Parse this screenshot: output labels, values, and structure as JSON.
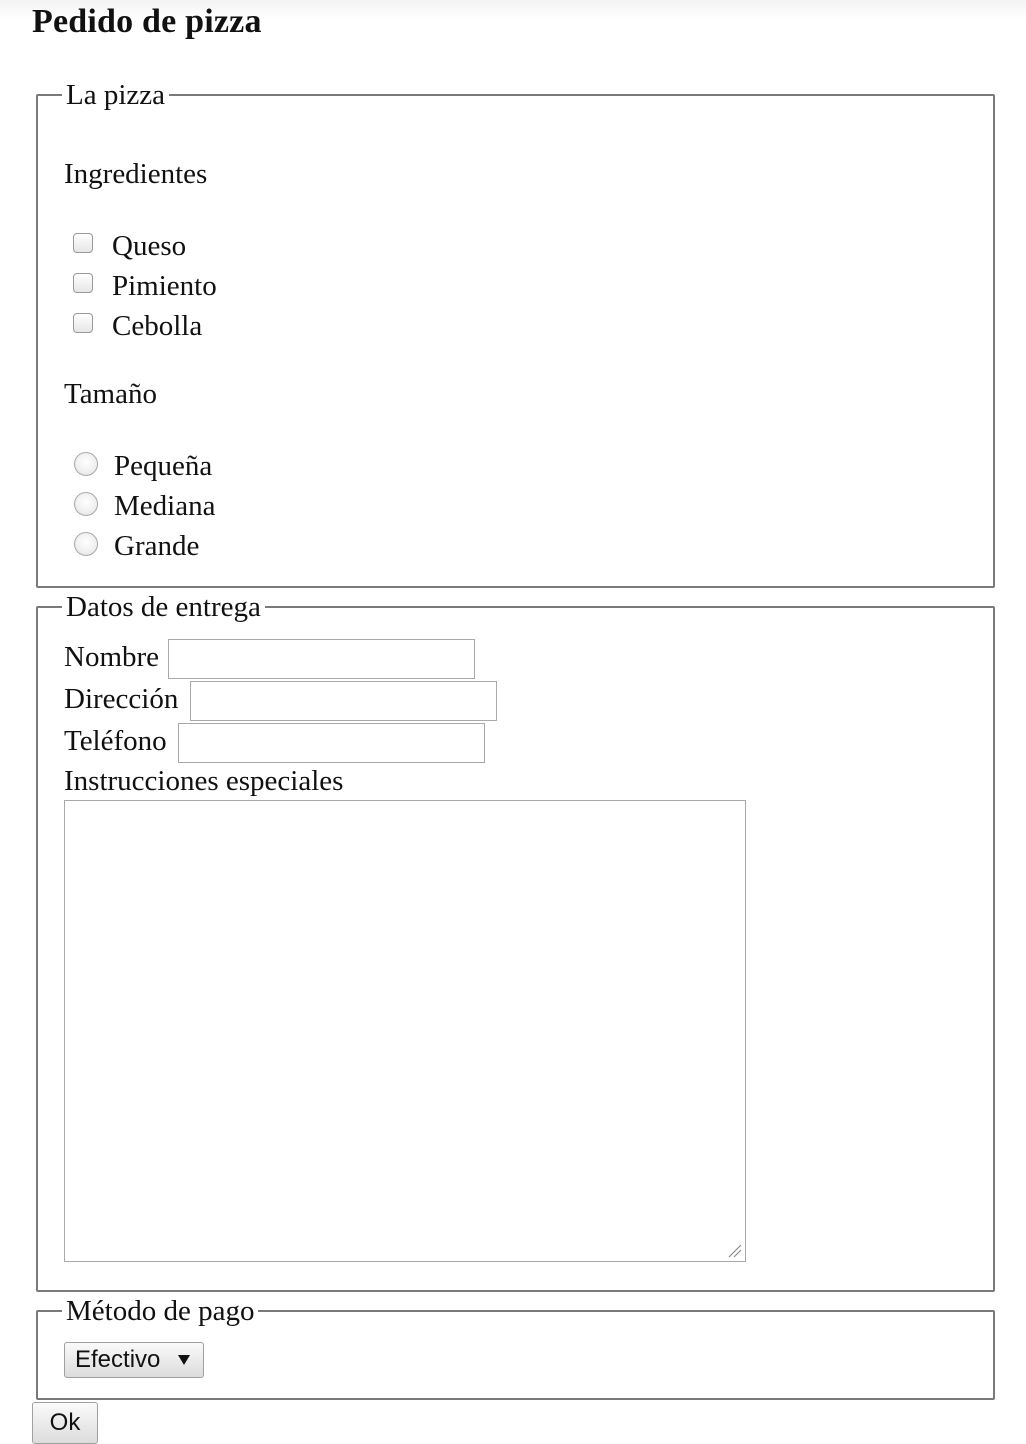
{
  "page": {
    "title": "Pedido de pizza"
  },
  "pizza": {
    "legend": "La pizza",
    "ingredients_title": "Ingredientes",
    "ingredients": [
      "Queso",
      "Pimiento",
      "Cebolla"
    ],
    "size_title": "Tamaño",
    "sizes": [
      "Pequeña",
      "Mediana",
      "Grande"
    ]
  },
  "delivery": {
    "legend": "Datos de entrega",
    "name_label": "Nombre",
    "name_value": "",
    "address_label": "Dirección",
    "address_value": "",
    "phone_label": "Teléfono",
    "phone_value": "",
    "instructions_label": "Instrucciones especiales",
    "instructions_value": ""
  },
  "payment": {
    "legend": "Método de pago",
    "selected": "Efectivo"
  },
  "submit": {
    "label": "Ok"
  }
}
